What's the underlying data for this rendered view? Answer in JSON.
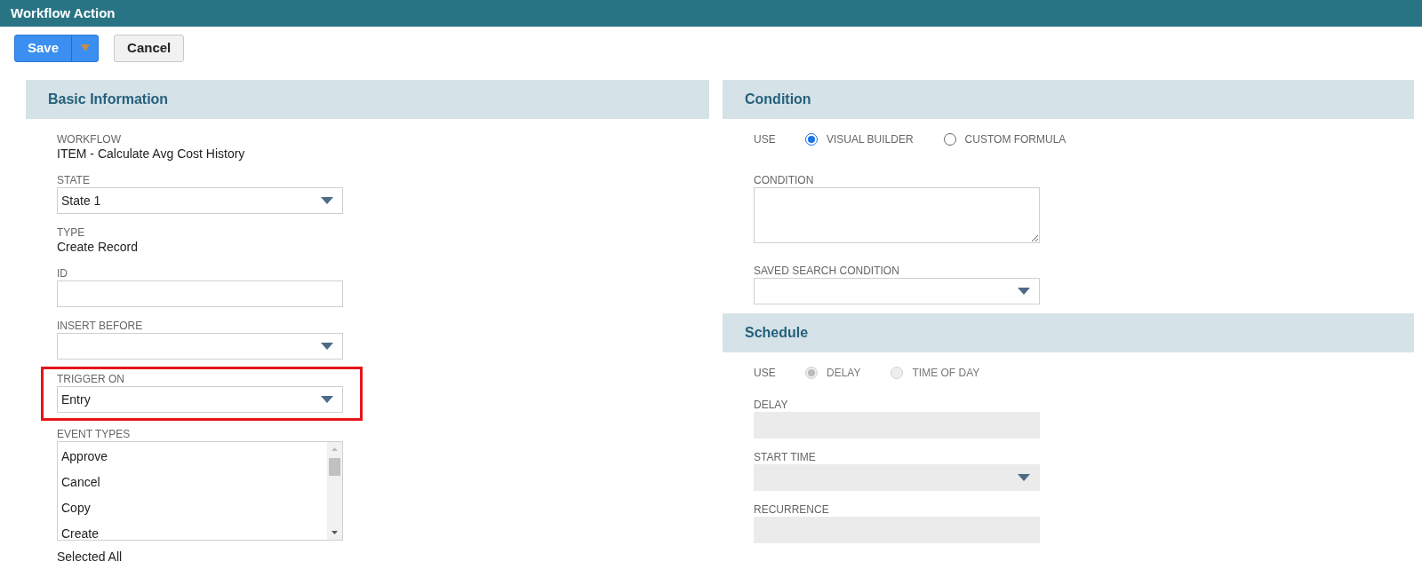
{
  "window": {
    "title": "Workflow Action"
  },
  "toolbar": {
    "save": {
      "label": "Save"
    },
    "cancel": {
      "label": "Cancel"
    }
  },
  "columns": [
    [
      {
        "title": "Basic Information",
        "fields": [
          {
            "kind": "static",
            "label": "WORKFLOW",
            "value": "ITEM - Calculate Avg Cost History"
          },
          {
            "kind": "select",
            "label": "STATE",
            "value": "State 1",
            "disabled": false
          },
          {
            "kind": "static",
            "label": "TYPE",
            "value": "Create Record"
          },
          {
            "kind": "input",
            "label": "ID",
            "disabled": false
          },
          {
            "kind": "select",
            "label": "INSERT BEFORE",
            "disabled": false
          },
          {
            "kind": "select",
            "label": "TRIGGER ON",
            "value": "Entry",
            "disabled": false,
            "highlighted": true
          },
          {
            "kind": "listbox",
            "label": "EVENT TYPES",
            "items": [
              "Approve",
              "Cancel",
              "Copy",
              "Create"
            ],
            "footer": "Selected All"
          }
        ]
      }
    ],
    [
      {
        "title": "Condition",
        "fields": [
          {
            "kind": "radio",
            "label": "USE",
            "disabled": false,
            "options": [
              {
                "label": "VISUAL BUILDER",
                "selected": true
              },
              {
                "label": "CUSTOM FORMULA",
                "selected": false
              }
            ]
          },
          {
            "kind": "textarea",
            "label": "CONDITION",
            "disabled": false
          },
          {
            "kind": "select",
            "label": "SAVED SEARCH CONDITION",
            "disabled": false
          }
        ]
      },
      {
        "title": "Schedule",
        "fields": [
          {
            "kind": "radio",
            "label": "USE",
            "disabled": true,
            "options": [
              {
                "label": "DELAY",
                "selected": true
              },
              {
                "label": "TIME OF DAY",
                "selected": false
              }
            ]
          },
          {
            "kind": "input",
            "label": "DELAY",
            "disabled": true
          },
          {
            "kind": "select",
            "label": "START TIME",
            "disabled": true
          },
          {
            "kind": "input",
            "label": "RECURRENCE",
            "disabled": true
          }
        ]
      }
    ]
  ]
}
